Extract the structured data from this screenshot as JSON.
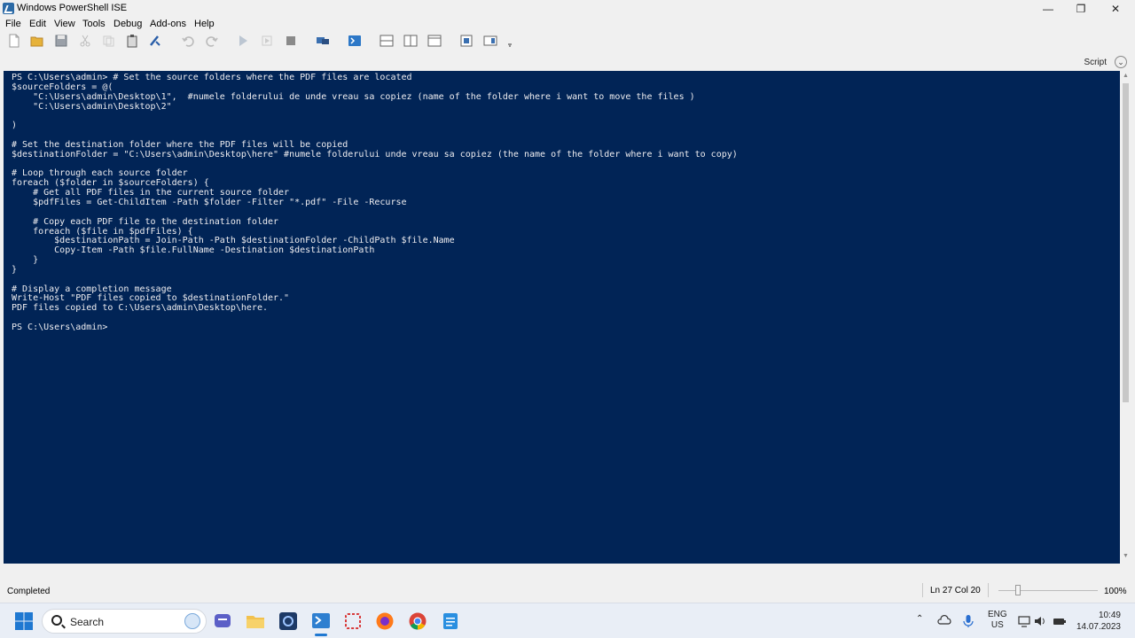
{
  "window": {
    "title": "Windows PowerShell ISE"
  },
  "menu": [
    "File",
    "Edit",
    "View",
    "Tools",
    "Debug",
    "Add-ons",
    "Help"
  ],
  "script_pane": {
    "label": "Script"
  },
  "console": {
    "lines": [
      "PS C:\\Users\\admin> # Set the source folders where the PDF files are located",
      "$sourceFolders = @(",
      "    \"C:\\Users\\admin\\Desktop\\1\",  #numele folderului de unde vreau sa copiez (name of the folder where i want to move the files )",
      "    \"C:\\Users\\admin\\Desktop\\2\"",
      "",
      ")",
      "",
      "# Set the destination folder where the PDF files will be copied",
      "$destinationFolder = \"C:\\Users\\admin\\Desktop\\here\" #numele folderului unde vreau sa copiez (the name of the folder where i want to copy)",
      "",
      "# Loop through each source folder",
      "foreach ($folder in $sourceFolders) {",
      "    # Get all PDF files in the current source folder",
      "    $pdfFiles = Get-ChildItem -Path $folder -Filter \"*.pdf\" -File -Recurse",
      "",
      "    # Copy each PDF file to the destination folder",
      "    foreach ($file in $pdfFiles) {",
      "        $destinationPath = Join-Path -Path $destinationFolder -ChildPath $file.Name",
      "        Copy-Item -Path $file.FullName -Destination $destinationPath",
      "    }",
      "}",
      "",
      "# Display a completion message",
      "Write-Host \"PDF files copied to $destinationFolder.\"",
      "PDF files copied to C:\\Users\\admin\\Desktop\\here.",
      "",
      "PS C:\\Users\\admin>"
    ]
  },
  "status": {
    "text": "Completed",
    "position": "Ln 27  Col 20",
    "zoom": "100%",
    "zoom_level": 1.0
  },
  "taskbar": {
    "search_label": "Search",
    "language": "ENG",
    "region": "US",
    "time": "10:49",
    "date": "14.07.2023"
  },
  "colors": {
    "console_bg": "#012456",
    "console_fg": "#eeedf0",
    "chrome": "#f0f0f0"
  }
}
